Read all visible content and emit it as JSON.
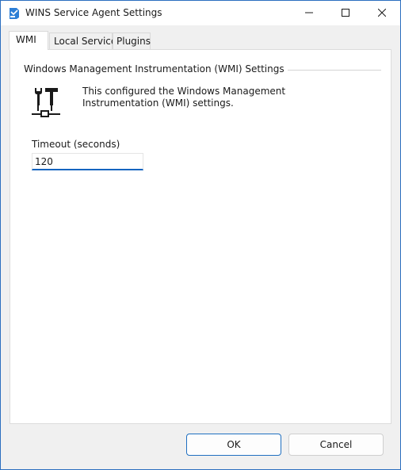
{
  "window": {
    "title": "WINS Service Agent Settings",
    "controls": {
      "minimize_icon": "minimize-icon",
      "maximize_icon": "maximize-icon",
      "close_icon": "close-icon"
    }
  },
  "tabs": [
    {
      "label": "WMI",
      "active": true
    },
    {
      "label": "Local Service",
      "active": false
    },
    {
      "label": "Plugins",
      "active": false
    }
  ],
  "wmi_panel": {
    "group_title": "Windows Management Instrumentation (WMI) Settings",
    "icon": "tools-icon",
    "description": "This configured the Windows Management Instrumentation (WMI) settings.",
    "timeout_label": "Timeout (seconds)",
    "timeout_value": "120"
  },
  "buttons": {
    "ok_label": "OK",
    "cancel_label": "Cancel"
  },
  "colors": {
    "accent": "#1565c0",
    "window_border": "#2b6fc0",
    "dialog_background": "#f0f0f0"
  }
}
